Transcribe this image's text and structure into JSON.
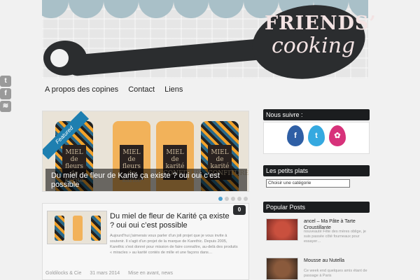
{
  "logo": {
    "line1": "FRIENDS’",
    "line2": "cooking"
  },
  "social": [
    {
      "icon": "twitter-icon",
      "glyph": "t"
    },
    {
      "icon": "facebook-icon",
      "glyph": "f"
    },
    {
      "icon": "rss-icon",
      "glyph": "≋"
    }
  ],
  "nav": {
    "items": [
      {
        "label": "A propos des copines"
      },
      {
        "label": "Contact"
      },
      {
        "label": "Liens"
      }
    ]
  },
  "slider": {
    "badge": "Featured",
    "caption": "Du miel de fleur de Karité ça existe ? oui oui c’est possible",
    "jar_text": "MIEL de fleurs de karité",
    "jar_text2": "MIEL de karité CONFITURE",
    "slide_count": 5,
    "active_index": 0
  },
  "post": {
    "title": "Du miel de fleur de Karité ça existe ? oui oui c’est possible",
    "excerpt": "Aujourd'hui j'aimerais vous parler d'un joli projet que je vous invite à soutenir. Il s'agit d'un projet de la marque de Karethic. Depuis 2005, Karethic s'est donné pour mission de faire connaître, au-delà des produits « miracles » au karité contés de mille et une façons dans…",
    "comments": "0",
    "author": "Goldilocks & Cie",
    "date": "31 mars 2014",
    "tags": "Mise en avant, news"
  },
  "sidebar": {
    "follow_title": "Nous suivre :",
    "follow_icons": [
      {
        "name": "facebook-icon",
        "glyph": "f",
        "color": "#2f5fa5"
      },
      {
        "name": "twitter-icon",
        "glyph": "t",
        "color": "#35a9e0"
      },
      {
        "name": "hellocoton-icon",
        "glyph": "✿",
        "color": "#d7327a"
      }
    ],
    "categories_title": "Les petits plats",
    "categories_select": "Choisir une catégorie",
    "popular_title": "Popular Posts",
    "popular": [
      {
        "title": "ancel – Ma Pâte à Tarte Croustillante",
        "desc": "nouveauté Fête des mères oblige, je suis passée côté fourneaux pour essayer…"
      },
      {
        "title": "Mousse au Nutella",
        "desc": "Ce week end quelques amis étant de passage à Paris"
      }
    ]
  },
  "colors": {
    "accent": "#1e7fb0",
    "dark": "#2b2d2f",
    "scallop": "#a9c0c8"
  }
}
